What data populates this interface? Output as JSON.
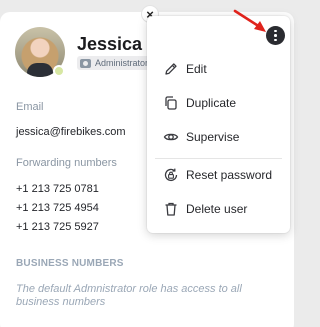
{
  "profile": {
    "name": "Jessica H",
    "role": "Administrator",
    "email_label": "Email",
    "email": "jessica@firebikes.com",
    "forwarding_label": "Forwarding numbers",
    "forwarding_numbers": [
      "+1 213 725 0781",
      "+1 213 725 4954",
      "+1 213 725 5927"
    ],
    "business_heading": "BUSINESS NUMBERS",
    "business_note": "The default Admnistrator role has access to all business numbers"
  },
  "close_label": "×",
  "menu": {
    "items": [
      {
        "label": "Edit",
        "icon": "pencil-icon"
      },
      {
        "label": "Duplicate",
        "icon": "copy-icon"
      },
      {
        "label": "Supervise",
        "icon": "eye-icon"
      },
      {
        "label": "Reset password",
        "icon": "lock-reset-icon"
      },
      {
        "label": "Delete user",
        "icon": "trash-icon"
      }
    ]
  },
  "colors": {
    "accent_dark": "#2a2b30",
    "annotation_red": "#e0231c",
    "muted_text": "#8a96a3",
    "status_dot": "#d7e7a3"
  }
}
